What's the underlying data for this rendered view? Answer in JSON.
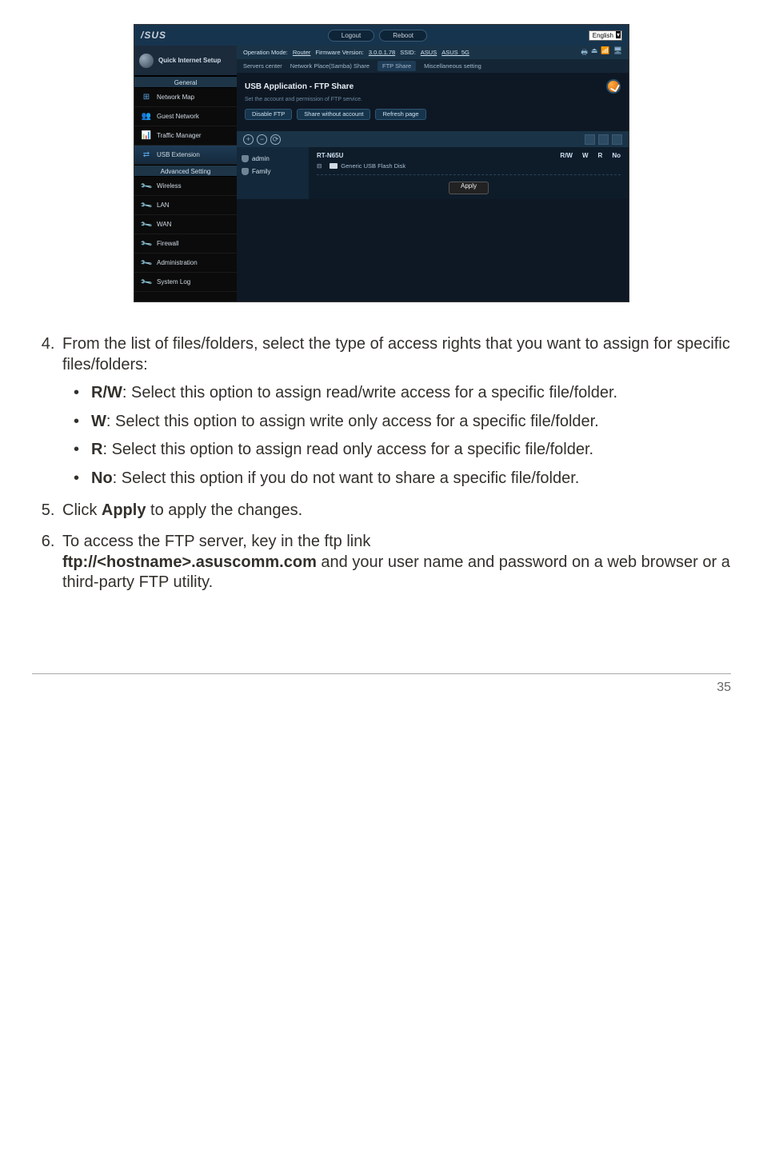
{
  "shot": {
    "logo": "/SUS",
    "top_buttons": {
      "logout": "Logout",
      "reboot": "Reboot"
    },
    "language": "English",
    "opmode": {
      "mode_label": "Operation Mode:",
      "mode_value": "Router",
      "fw_label": "Firmware Version:",
      "fw_value": "3.0.0.1.78",
      "ssid_label": "SSID:",
      "ssid1": "ASUS",
      "ssid2": "ASUS_5G"
    },
    "tabs": [
      "Servers center",
      "Network Place(Samba) Share",
      "FTP Share",
      "Miscellaneous setting"
    ],
    "panel": {
      "title": "USB Application - FTP Share",
      "subtitle": "Set the account and permission of FTP service.",
      "btns": [
        "Disable FTP",
        "Share without account",
        "Refresh page"
      ]
    },
    "users": [
      "admin",
      "Family"
    ],
    "share": {
      "device": "RT-N65U",
      "drive": "Generic USB Flash Disk",
      "cols": [
        "R/W",
        "W",
        "R",
        "No"
      ],
      "apply": "Apply"
    },
    "sidebar": {
      "qis": "Quick Internet Setup",
      "general_head": "General",
      "items_general": [
        "Network Map",
        "Guest Network",
        "Traffic Manager",
        "USB Extension"
      ],
      "adv_head": "Advanced Setting",
      "items_adv": [
        "Wireless",
        "LAN",
        "WAN",
        "Firewall",
        "Administration",
        "System Log"
      ]
    }
  },
  "doc": {
    "li4_a": "From the list of files/folders, select the type of access rights that you want to assign for specific files/folders:",
    "rw": {
      "label": "R/W",
      "text": ": Select this option to assign read/write access for a specific file/folder."
    },
    "w": {
      "label": "W",
      "text": ": Select this option to assign write only access for a specific file/folder."
    },
    "r": {
      "label": "R",
      "text": ": Select this option to assign read only access for a specific file/folder."
    },
    "no": {
      "label": "No",
      "text": ": Select this option if you do not want to share a specific file/folder."
    },
    "li5_a": "Click ",
    "li5_b": "Apply",
    "li5_c": " to apply the changes.",
    "li6_a": "To access the FTP server, key in the ftp link ",
    "li6_b": "ftp://<hostname>.asuscomm.com",
    "li6_c": " and your user name and password on a web browser or a third-party FTP utility."
  },
  "page_number": "35"
}
